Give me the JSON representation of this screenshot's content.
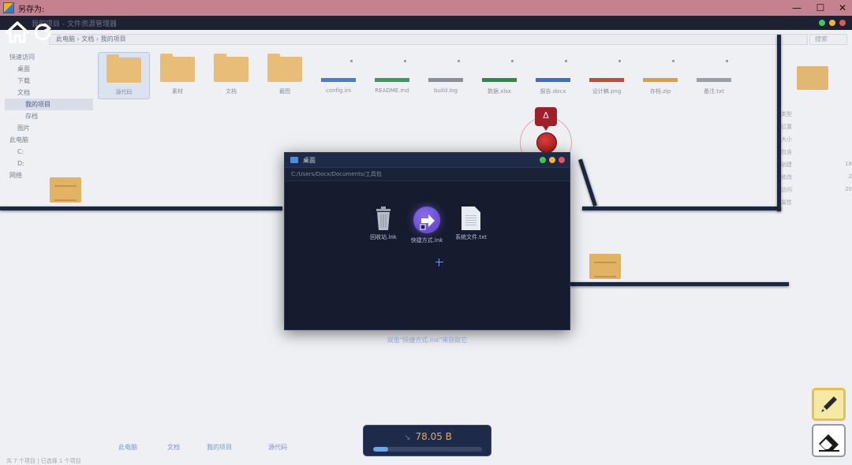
{
  "os_window": {
    "title": "另存为:",
    "minimize": "—",
    "maximize": "☐",
    "close": "✕"
  },
  "bg_explorer": {
    "window_title": "我的项目 - 文件资源管理器",
    "address": "此电脑  ›  文档  ›  我的项目",
    "search_placeholder": "搜索",
    "sidebar": [
      {
        "label": "快速访问",
        "level": "top",
        "selected": false
      },
      {
        "label": "桌面",
        "level": "indent1",
        "selected": false
      },
      {
        "label": "下载",
        "level": "indent1",
        "selected": false
      },
      {
        "label": "文档",
        "level": "indent1",
        "selected": false
      },
      {
        "label": "我的项目",
        "level": "indent2",
        "selected": true
      },
      {
        "label": "存档",
        "level": "indent2",
        "selected": false
      },
      {
        "label": "图片",
        "level": "indent1",
        "selected": false
      },
      {
        "label": "此电脑",
        "level": "top",
        "selected": false
      },
      {
        "label": "C:",
        "level": "indent1",
        "selected": false
      },
      {
        "label": "D:",
        "level": "indent1",
        "selected": false
      },
      {
        "label": "网络",
        "level": "top",
        "selected": false
      }
    ],
    "files": [
      {
        "name": "源代码",
        "kind": "folder",
        "selected": true
      },
      {
        "name": "素材",
        "kind": "folder",
        "selected": false
      },
      {
        "name": "文档",
        "kind": "folder",
        "selected": false
      },
      {
        "name": "截图",
        "kind": "folder",
        "selected": false
      },
      {
        "name": "config.ini",
        "kind": "file",
        "color": "#4a7cc8",
        "selected": false
      },
      {
        "name": "README.md",
        "kind": "file",
        "color": "#3c9a5c",
        "selected": false
      },
      {
        "name": "build.log",
        "kind": "file",
        "color": "#8a8f9a",
        "selected": false
      },
      {
        "name": "数据.xlsx",
        "kind": "file",
        "color": "#2f8a4a",
        "selected": false
      },
      {
        "name": "报告.docx",
        "kind": "file",
        "color": "#3a6fc4",
        "selected": false
      },
      {
        "name": "设计稿.png",
        "kind": "file",
        "color": "#c24b3a",
        "selected": false
      },
      {
        "name": "存档.zip",
        "kind": "file",
        "color": "#d8a040",
        "selected": false
      },
      {
        "name": "备注.txt",
        "kind": "file",
        "color": "#9a9fa8",
        "selected": false
      }
    ],
    "details": [
      {
        "key": "类型",
        "value": ""
      },
      {
        "key": "位置",
        "value": ""
      },
      {
        "key": "大小",
        "value": ""
      },
      {
        "key": "包含",
        "value": ""
      },
      {
        "key": "创建",
        "value": "18"
      },
      {
        "key": "修改",
        "value": "2"
      },
      {
        "key": "访问",
        "value": "20"
      },
      {
        "key": "属性",
        "value": ""
      }
    ],
    "status": "共 7 个项目  |  已选择 1 个项目",
    "bottom_crumbs": [
      "此电脑",
      "文档",
      "我的项目",
      "源代码"
    ]
  },
  "enemy": {
    "alert_symbol": "Δ"
  },
  "modal": {
    "title": "桌面",
    "path": "C:/Users/Docx/Documents/工具包",
    "icons": [
      {
        "label": "回收站.lnk",
        "kind": "trash"
      },
      {
        "label": "快捷方式.lnk",
        "kind": "shortcut"
      },
      {
        "label": "系统文件.txt",
        "kind": "text"
      }
    ]
  },
  "hint": "双击\"快捷方式.lnk\"来获取它",
  "hud": {
    "storage_value": "78.05 B",
    "storage_glyph": "↘",
    "storage_fraction": 0.14
  },
  "colors": {
    "os_titlebar": "#c4818f",
    "rail": "#1b2740",
    "accent_orange": "#f0a848",
    "dot_green": "#3cc85a",
    "dot_yellow": "#f0b43c",
    "dot_red": "#e8545a"
  }
}
